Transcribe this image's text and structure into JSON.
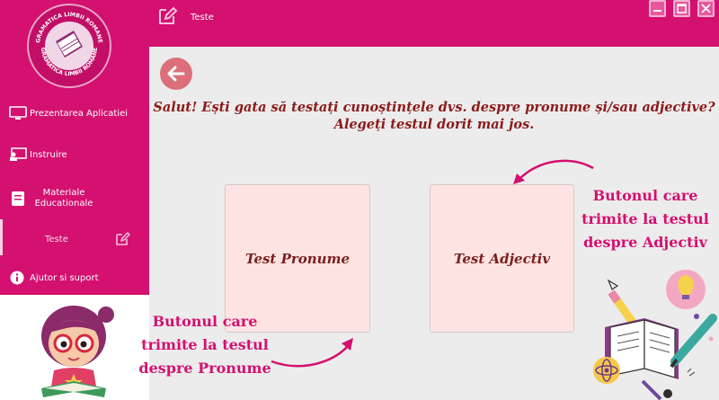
{
  "app": {
    "logo_text": "GRAMATICA LIMBII ROMANE",
    "page_title": "Teste"
  },
  "sidebar": {
    "items": [
      {
        "label": "Prezentarea Aplicatiei",
        "icon": "monitor-icon"
      },
      {
        "label": "Instruire",
        "icon": "teacher-icon"
      },
      {
        "label": "Materiale Educationale",
        "label_line1": "Materiale",
        "label_line2": "Educationale",
        "icon": "book-icon"
      },
      {
        "label": "Teste",
        "icon": "edit-icon",
        "active": true
      },
      {
        "label": "Ajutor si suport",
        "icon": "info-icon"
      }
    ]
  },
  "main": {
    "heading_line1": "Salut! Ești gata să testați cunoștințele dvs. despre pronume și/sau adjective?",
    "heading_line2": "Alegeți testul dorit mai jos.",
    "buttons": [
      {
        "label": "Test Pronume"
      },
      {
        "label": "Test Adjectiv"
      }
    ]
  },
  "annotations": {
    "right": [
      "Butonul care",
      "trimite la testul",
      "despre Adjectiv"
    ],
    "left": [
      "Butonul care",
      "trimite la testul",
      "despre Pronume"
    ]
  },
  "colors": {
    "brand": "#d41070",
    "main_bg": "#ececec",
    "card_bg": "#fde4e2",
    "heading": "#8b1a1a",
    "back_button": "#dc6f7a"
  }
}
